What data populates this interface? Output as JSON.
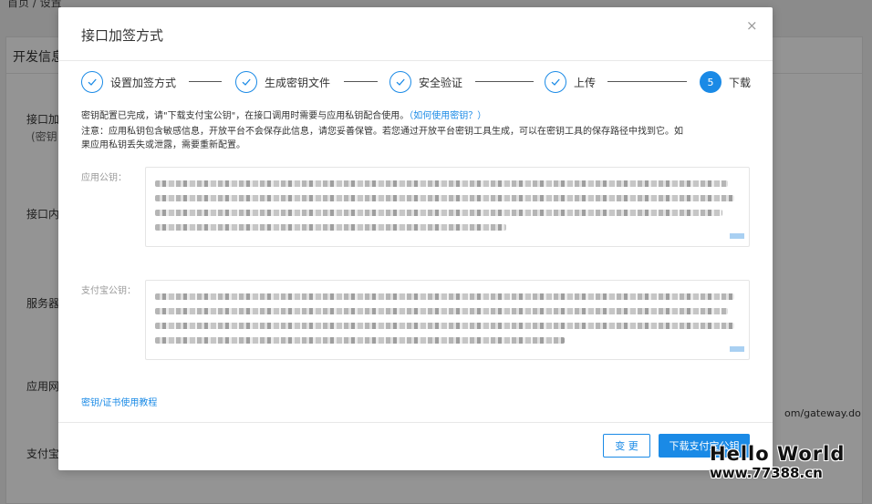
{
  "background": {
    "breadcrumb": "首页 / 设置",
    "card_title": "开发信息",
    "labels": [
      "接口加",
      "(密钥",
      "接口内",
      "服务器",
      "应用网",
      "支付宝"
    ],
    "partial_url": "om/gateway.do"
  },
  "modal": {
    "title": "接口加签方式",
    "close_symbol": "×",
    "steps": [
      {
        "label": "设置加签方式",
        "state": "done"
      },
      {
        "label": "生成密钥文件",
        "state": "done"
      },
      {
        "label": "安全验证",
        "state": "done"
      },
      {
        "label": "上传",
        "state": "done"
      },
      {
        "number": "5",
        "label": "下载",
        "state": "active"
      }
    ],
    "info_line1": "密钥配置已完成，请\"下载支付宝公钥\"，在接口调用时需要与应用私钥配合使用。",
    "info_link": "（如何使用密钥？）",
    "info_line2": "注意：应用私钥包含敏感信息，开放平台不会保存此信息，请您妥善保管。若您通过开放平台密钥工具生成，可以在密钥工具的保存路径中找到它。如",
    "info_line3": "果应用私钥丢失或泄露，需要重新配置。",
    "app_public_key_label": "应用公钥：",
    "alipay_public_key_label": "支付宝公钥：",
    "tutorial_link": "密钥/证书使用教程",
    "change_button": "变 更",
    "download_button": "下载支付宝公钥"
  },
  "watermark": {
    "line1": "Hello World",
    "line2": "www.77388.cn"
  },
  "colors": {
    "accent": "#1a8ae6",
    "overlay": "rgba(0,0,0,0.42)"
  }
}
